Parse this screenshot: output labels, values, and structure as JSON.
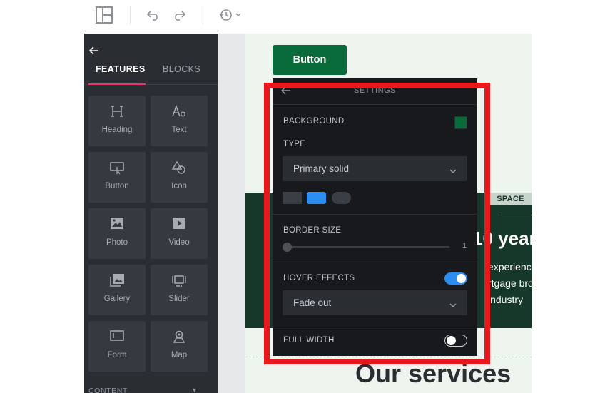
{
  "toolbar": {
    "layout_icon": "layout-panels-icon",
    "undo_icon": "undo-icon",
    "redo_icon": "redo-icon",
    "history_icon": "history-icon"
  },
  "panel": {
    "tabs": [
      {
        "label": "FEATURES",
        "active": true
      },
      {
        "label": "BLOCKS",
        "active": false
      }
    ],
    "tiles": [
      {
        "label": "Heading",
        "icon": "heading-icon"
      },
      {
        "label": "Text",
        "icon": "text-icon"
      },
      {
        "label": "Button",
        "icon": "button-icon"
      },
      {
        "label": "Icon",
        "icon": "shapes-icon"
      },
      {
        "label": "Photo",
        "icon": "photo-icon"
      },
      {
        "label": "Video",
        "icon": "video-icon"
      },
      {
        "label": "Gallery",
        "icon": "gallery-icon"
      },
      {
        "label": "Slider",
        "icon": "slider-icon"
      },
      {
        "label": "Form",
        "icon": "form-icon"
      },
      {
        "label": "Map",
        "icon": "map-pin-icon"
      }
    ],
    "content_header": "CONTENT"
  },
  "site": {
    "button_label": "Button",
    "space_tag": "SPACE",
    "hero_heading": "10 year",
    "hero_lines": [
      "experience in",
      "rtgage broke",
      "industry"
    ],
    "services_heading": "Our services"
  },
  "settings": {
    "title": "SETTINGS",
    "background_label": "BACKGROUND",
    "background_color": "#0a6b3a",
    "type_label": "TYPE",
    "type_value": "Primary solid",
    "shape_chips": [
      {
        "shape": "square",
        "color": "#3a3f46",
        "selected": false
      },
      {
        "shape": "rounded",
        "color": "#2d8cf0",
        "selected": true
      },
      {
        "shape": "pill",
        "color": "#3a3f46",
        "selected": false
      }
    ],
    "border_size_label": "BORDER SIZE",
    "border_size_value": "1",
    "hover_effects_label": "HOVER EFFECTS",
    "hover_effects_on": true,
    "hover_effect_value": "Fade out",
    "full_width_label": "FULL WIDTH",
    "full_width_on": false
  },
  "colors": {
    "accent": "#2d8cf0",
    "tab_underline": "#e8336d",
    "highlight": "#e8181c",
    "site_green": "#0a6b3a"
  }
}
